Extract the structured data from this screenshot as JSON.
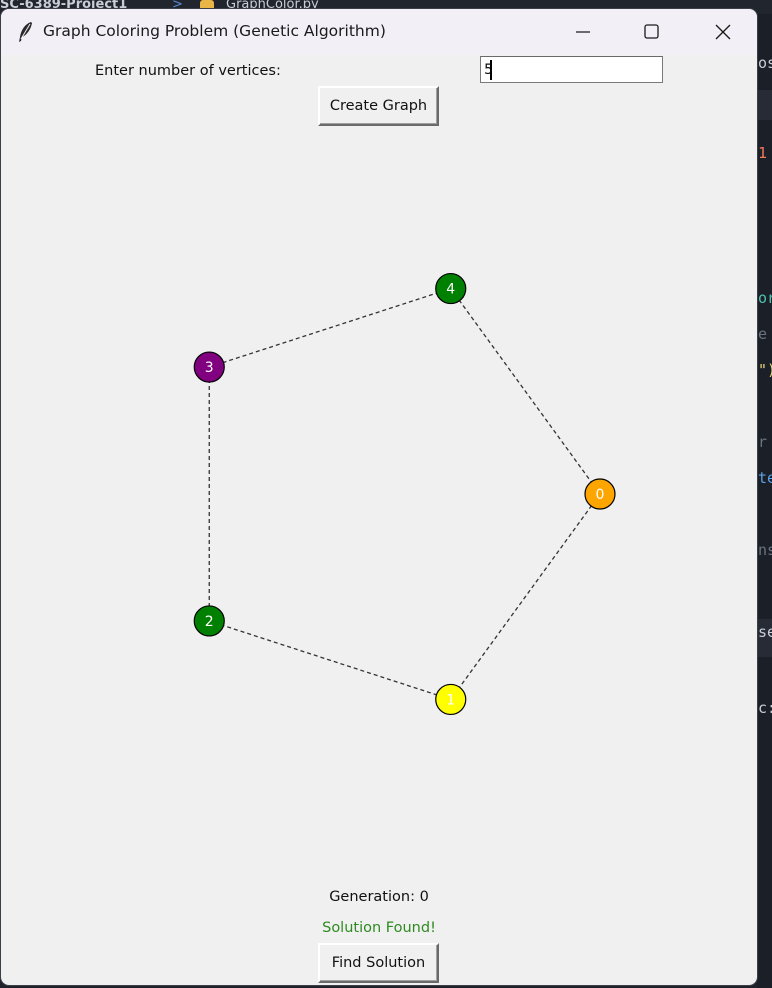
{
  "background": {
    "breadcrumb": "SC-6389-Project1",
    "separator": ">",
    "file_name": "GraphColor.py",
    "right_fragments": [
      "osa",
      "1",
      "or",
      "e",
      "\")",
      "r",
      "te",
      "ns",
      "se",
      "c:"
    ]
  },
  "window": {
    "title": "Graph Coloring Problem (Genetic Algorithm)",
    "icon": "feather-icon",
    "controls": [
      "minimize-icon",
      "maximize-icon",
      "close-icon"
    ]
  },
  "form": {
    "prompt_label": "Enter number of vertices:",
    "vertex_count_value": "5",
    "create_button_label": "Create Graph"
  },
  "graph": {
    "vertices": [
      {
        "id": "0",
        "color": "#ffa500",
        "label_color": "#ffffff"
      },
      {
        "id": "1",
        "color": "#ffff00",
        "label_color": "#ffffff"
      },
      {
        "id": "2",
        "color": "#008000",
        "label_color": "#ffffff"
      },
      {
        "id": "3",
        "color": "#800080",
        "label_color": "#ffffff"
      },
      {
        "id": "4",
        "color": "#008000",
        "label_color": "#ffffff"
      }
    ],
    "edges": [
      [
        "0",
        "1"
      ],
      [
        "1",
        "2"
      ],
      [
        "2",
        "3"
      ],
      [
        "3",
        "4"
      ],
      [
        "4",
        "0"
      ]
    ],
    "edge_style": "dashed"
  },
  "footer": {
    "generation_text": "Generation: 0",
    "status_text": "Solution Found!",
    "status_color": "#2e8b20",
    "find_button_label": "Find Solution"
  }
}
